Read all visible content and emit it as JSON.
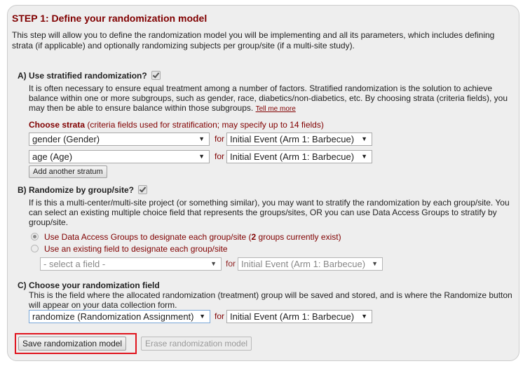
{
  "step": {
    "title": "STEP 1: Define your randomization model",
    "intro": "This step will allow you to define the randomization model you will be implementing and all its parameters, which includes defining strata (if applicable) and optionally randomizing subjects per group/site (if a multi-site study)."
  },
  "section_a": {
    "heading": "A) Use stratified randomization?",
    "checked": true,
    "description": "It is often necessary to ensure equal treatment among a number of factors. Stratified randomization is the solution to achieve balance within one or more subgroups, such as gender, race, diabetics/non-diabetics, etc. By choosing strata (criteria fields), you may then be able to ensure balance within those subgroups.",
    "tell_me_more": "Tell me more",
    "strata_label": "Choose strata",
    "strata_hint": "(criteria fields used for stratification; may specify up to 14 fields)",
    "strata": [
      {
        "field": "gender (Gender)",
        "for_label": "for",
        "event": "Initial Event (Arm 1: Barbecue)"
      },
      {
        "field": "age (Age)",
        "for_label": "for",
        "event": "Initial Event (Arm 1: Barbecue)"
      }
    ],
    "add_button": "Add another stratum"
  },
  "section_b": {
    "heading": "B) Randomize by group/site?",
    "checked": true,
    "description": "If is this a multi-center/multi-site project (or something similar), you may want to stratify the randomization by each group/site. You can select an existing multiple choice field that represents the groups/sites, OR you can use Data Access Groups to stratify by group/site.",
    "option_dag_prefix": "Use Data Access Groups to designate each group/site (",
    "option_dag_count": "2",
    "option_dag_suffix": " groups currently exist)",
    "option_dag_selected": true,
    "option_field": "Use an existing field to designate each group/site",
    "option_field_selected": false,
    "field_select": "- select a field -",
    "for_label": "for",
    "event_select": "Initial Event (Arm 1: Barbecue)"
  },
  "section_c": {
    "heading": "C) Choose your randomization field",
    "description": "This is the field where the allocated randomization (treatment) group will be saved and stored, and is where the Randomize button will appear on your data collection form.",
    "field_select": "randomize (Randomization Assignment)",
    "for_label": "for",
    "event_select": "Initial Event (Arm 1: Barbecue)"
  },
  "actions": {
    "save": "Save randomization model",
    "erase": "Erase randomization model"
  },
  "icons": {
    "dropdown": "▼"
  },
  "colors": {
    "accent": "#800000",
    "highlight": "#e0141e",
    "panel_bg": "#eeeeee"
  }
}
